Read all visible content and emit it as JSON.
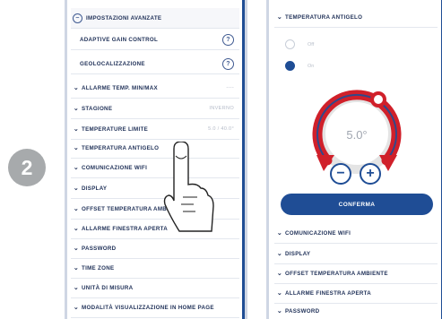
{
  "step_number": "2",
  "left_screen": {
    "advanced_header": "IMPOSTAZIONI AVANZATE",
    "sub_items": [
      {
        "label": "ADAPTIVE GAIN CONTROL"
      },
      {
        "label": "GEOLOCALIZZAZIONE"
      }
    ],
    "items": [
      {
        "label": "ALLARME TEMP. MIN/MAX",
        "value": "----"
      },
      {
        "label": "STAGIONE",
        "value": "Inverno"
      },
      {
        "label": "TEMPERATURE LIMITE",
        "value": "5.0 / 40.0°"
      },
      {
        "label": "TEMPERATURA ANTIGELO",
        "value": ""
      },
      {
        "label": "COMUNICAZIONE WIFI",
        "value": ""
      },
      {
        "label": "DISPLAY",
        "value": ""
      },
      {
        "label": "OFFSET TEMPERATURA AMBIENTE",
        "value": ""
      },
      {
        "label": "ALLARME FINESTRA APERTA",
        "value": ""
      },
      {
        "label": "PASSWORD",
        "value": ""
      },
      {
        "label": "TIME ZONE",
        "value": ""
      },
      {
        "label": "UNITÀ DI MISURA",
        "value": ""
      },
      {
        "label": "MODALITÀ VISUALIZZAZIONE IN HOME PAGE",
        "value": ""
      }
    ]
  },
  "right_screen": {
    "section_title": "TEMPERATURA ANTIGELO",
    "options": [
      {
        "label": "Off",
        "selected": false
      },
      {
        "label": "On",
        "selected": true
      }
    ],
    "dial_value": "5.0°",
    "minus_label": "−",
    "plus_label": "+",
    "confirm_label": "CONFERMA",
    "items": [
      {
        "label": "COMUNICAZIONE WIFI"
      },
      {
        "label": "DISPLAY"
      },
      {
        "label": "OFFSET TEMPERATURA AMBIENTE"
      },
      {
        "label": "ALLARME FINESTRA APERTA"
      },
      {
        "label": "PASSWORD"
      }
    ]
  },
  "colors": {
    "brand_blue": "#1f4d95",
    "dial_red": "#d0202a",
    "badge_gray": "#a7aaac"
  }
}
